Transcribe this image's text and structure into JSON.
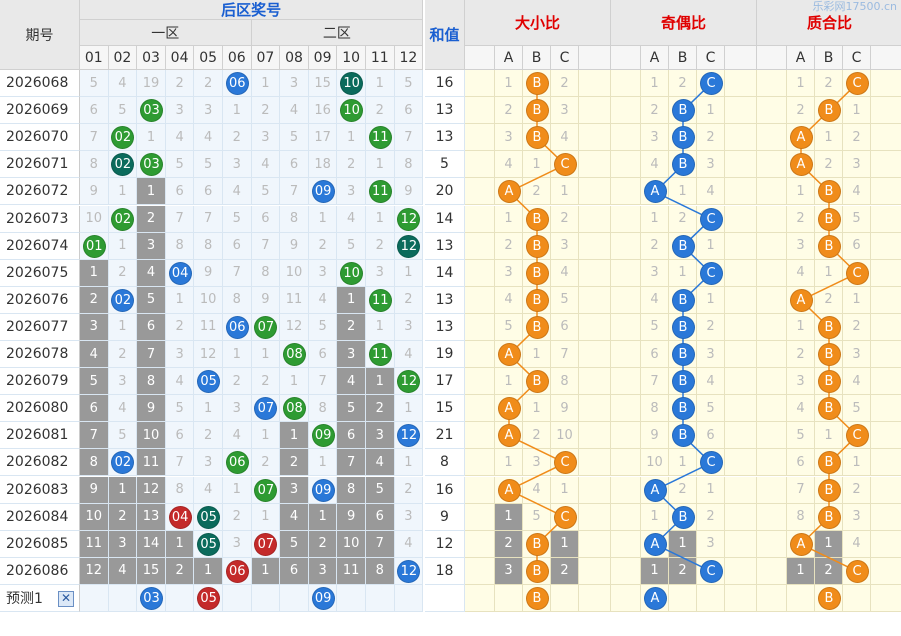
{
  "watermark": "乐彩网17500.cn",
  "header": {
    "period": "期号",
    "back_area": "后区奖号",
    "zone1": "一区",
    "zone2": "二区",
    "sum": "和值",
    "size_ratio": "大小比",
    "odd_even": "奇偶比",
    "prime_ratio": "质合比"
  },
  "numbers": [
    "01",
    "02",
    "03",
    "04",
    "05",
    "06",
    "07",
    "08",
    "09",
    "10",
    "11",
    "12"
  ],
  "abc": [
    "A",
    "B",
    "C"
  ],
  "predict_label": "预测1",
  "predict_close": "✕",
  "colors": {
    "green": "#2e9b32",
    "teal": "#0b6b5c",
    "blue": "#2a78d8",
    "red": "#c42a2a",
    "orange": "#f08c1a",
    "header_blue": "#1a5fd1",
    "header_red": "#e00000"
  },
  "rows": [
    {
      "id": "2026068",
      "c": [
        "5",
        "4",
        "19",
        "2",
        "2",
        "b:06:blue",
        "1",
        "3",
        "15",
        "b:10:teal",
        "1",
        "5"
      ],
      "sum": "16",
      "s": [
        "1",
        "b:B",
        "2"
      ],
      "o": [
        "1",
        "2",
        "b:C"
      ],
      "p": [
        "1",
        "2",
        "b:C"
      ]
    },
    {
      "id": "2026069",
      "c": [
        "6",
        "5",
        "b:03:green",
        "3",
        "3",
        "1",
        "2",
        "4",
        "16",
        "b:10:green",
        "2",
        "6"
      ],
      "sum": "13",
      "s": [
        "2",
        "b:B",
        "3"
      ],
      "o": [
        "2",
        "b:B",
        "1"
      ],
      "p": [
        "2",
        "b:B",
        "1"
      ]
    },
    {
      "id": "2026070",
      "c": [
        "7",
        "b:02:green",
        "1",
        "4",
        "4",
        "2",
        "3",
        "5",
        "17",
        "1",
        "b:11:green",
        "7"
      ],
      "sum": "13",
      "s": [
        "3",
        "b:B",
        "4"
      ],
      "o": [
        "3",
        "b:B",
        "2"
      ],
      "p": [
        "b:A",
        "1",
        "2"
      ]
    },
    {
      "id": "2026071",
      "c": [
        "8",
        "b:02:teal",
        "b:03:green",
        "5",
        "5",
        "3",
        "4",
        "6",
        "18",
        "2",
        "1",
        "8"
      ],
      "sum": "5",
      "s": [
        "4",
        "1",
        "b:C"
      ],
      "o": [
        "4",
        "b:B",
        "3"
      ],
      "p": [
        "b:A",
        "2",
        "3"
      ]
    },
    {
      "id": "2026072",
      "c": [
        "9",
        "1",
        "g:1",
        "6",
        "6",
        "4",
        "5",
        "7",
        "b:09:blue",
        "3",
        "b:11:green",
        "9"
      ],
      "sum": "20",
      "s": [
        "b:A",
        "2",
        "1"
      ],
      "o": [
        "b:A",
        "1",
        "4"
      ],
      "p": [
        "1",
        "b:B",
        "4"
      ]
    },
    {
      "id": "2026073",
      "c": [
        "10",
        "b:02:green",
        "g:2",
        "7",
        "7",
        "5",
        "6",
        "8",
        "1",
        "4",
        "1",
        "b:12:green"
      ],
      "sum": "14",
      "s": [
        "1",
        "b:B",
        "2"
      ],
      "o": [
        "1",
        "2",
        "b:C"
      ],
      "p": [
        "2",
        "b:B",
        "5"
      ]
    },
    {
      "id": "2026074",
      "c": [
        "b:01:green",
        "1",
        "g:3",
        "8",
        "8",
        "6",
        "7",
        "9",
        "2",
        "5",
        "2",
        "b:12:teal"
      ],
      "sum": "13",
      "s": [
        "2",
        "b:B",
        "3"
      ],
      "o": [
        "2",
        "b:B",
        "1"
      ],
      "p": [
        "3",
        "b:B",
        "6"
      ]
    },
    {
      "id": "2026075",
      "c": [
        "g:1",
        "2",
        "g:4",
        "b:04:blue",
        "9",
        "7",
        "8",
        "10",
        "3",
        "b:10:green",
        "3",
        "1"
      ],
      "sum": "14",
      "s": [
        "3",
        "b:B",
        "4"
      ],
      "o": [
        "3",
        "1",
        "b:C"
      ],
      "p": [
        "4",
        "1",
        "b:C"
      ]
    },
    {
      "id": "2026076",
      "c": [
        "g:2",
        "b:02:blue",
        "g:5",
        "1",
        "10",
        "8",
        "9",
        "11",
        "4",
        "g:1",
        "b:11:green",
        "2"
      ],
      "sum": "13",
      "s": [
        "4",
        "b:B",
        "5"
      ],
      "o": [
        "4",
        "b:B",
        "1"
      ],
      "p": [
        "b:A",
        "2",
        "1"
      ]
    },
    {
      "id": "2026077",
      "c": [
        "g:3",
        "1",
        "g:6",
        "2",
        "11",
        "b:06:blue",
        "b:07:green",
        "12",
        "5",
        "g:2",
        "1",
        "3"
      ],
      "sum": "13",
      "s": [
        "5",
        "b:B",
        "6"
      ],
      "o": [
        "5",
        "b:B",
        "2"
      ],
      "p": [
        "1",
        "b:B",
        "2"
      ]
    },
    {
      "id": "2026078",
      "c": [
        "g:4",
        "2",
        "g:7",
        "3",
        "12",
        "1",
        "1",
        "b:08:green",
        "6",
        "g:3",
        "b:11:green",
        "4"
      ],
      "sum": "19",
      "s": [
        "b:A",
        "1",
        "7"
      ],
      "o": [
        "6",
        "b:B",
        "3"
      ],
      "p": [
        "2",
        "b:B",
        "3"
      ]
    },
    {
      "id": "2026079",
      "c": [
        "g:5",
        "3",
        "g:8",
        "4",
        "b:05:blue",
        "2",
        "2",
        "1",
        "7",
        "g:4",
        "g:1",
        "b:12:green"
      ],
      "sum": "17",
      "s": [
        "1",
        "b:B",
        "8"
      ],
      "o": [
        "7",
        "b:B",
        "4"
      ],
      "p": [
        "3",
        "b:B",
        "4"
      ]
    },
    {
      "id": "2026080",
      "c": [
        "g:6",
        "4",
        "g:9",
        "5",
        "1",
        "3",
        "b:07:blue",
        "b:08:green",
        "8",
        "g:5",
        "g:2",
        "1"
      ],
      "sum": "15",
      "s": [
        "b:A",
        "1",
        "9"
      ],
      "o": [
        "8",
        "b:B",
        "5"
      ],
      "p": [
        "4",
        "b:B",
        "5"
      ]
    },
    {
      "id": "2026081",
      "c": [
        "g:7",
        "5",
        "g:10",
        "6",
        "2",
        "4",
        "1",
        "g:1",
        "b:09:green",
        "g:6",
        "g:3",
        "b:12:blue"
      ],
      "sum": "21",
      "s": [
        "b:A",
        "2",
        "10"
      ],
      "o": [
        "9",
        "b:B",
        "6"
      ],
      "p": [
        "5",
        "1",
        "b:C"
      ]
    },
    {
      "id": "2026082",
      "c": [
        "g:8",
        "b:02:blue",
        "g:11",
        "7",
        "3",
        "b:06:green",
        "2",
        "g:2",
        "1",
        "g:7",
        "g:4",
        "1"
      ],
      "sum": "8",
      "s": [
        "1",
        "3",
        "b:C"
      ],
      "o": [
        "10",
        "1",
        "b:C"
      ],
      "p": [
        "6",
        "b:B",
        "1"
      ]
    },
    {
      "id": "2026083",
      "c": [
        "g:9",
        "g:1",
        "g:12",
        "8",
        "4",
        "1",
        "b:07:green",
        "g:3",
        "b:09:blue",
        "g:8",
        "g:5",
        "2"
      ],
      "sum": "16",
      "s": [
        "b:A",
        "4",
        "1"
      ],
      "o": [
        "b:A",
        "2",
        "1"
      ],
      "p": [
        "7",
        "b:B",
        "2"
      ]
    },
    {
      "id": "2026084",
      "c": [
        "g:10",
        "g:2",
        "g:13",
        "b:04:red",
        "b:05:teal",
        "2",
        "1",
        "g:4",
        "g:1",
        "g:9",
        "g:6",
        "3"
      ],
      "sum": "9",
      "s": [
        "g:1",
        "5",
        "b:C"
      ],
      "o": [
        "1",
        "b:B",
        "2"
      ],
      "p": [
        "8",
        "b:B",
        "3"
      ]
    },
    {
      "id": "2026085",
      "c": [
        "g:11",
        "g:3",
        "g:14",
        "g:1",
        "b:05:teal",
        "3",
        "b:07:red",
        "g:5",
        "g:2",
        "g:10",
        "g:7",
        "4"
      ],
      "sum": "12",
      "s": [
        "g:2",
        "b:B",
        "g:1"
      ],
      "o": [
        "b:A",
        "g:1",
        "3"
      ],
      "p": [
        "b:A",
        "g:1",
        "4"
      ]
    },
    {
      "id": "2026086",
      "c": [
        "g:12",
        "g:4",
        "g:15",
        "g:2",
        "g:1",
        "b:06:red",
        "g:1",
        "g:6",
        "g:3",
        "g:11",
        "g:8",
        "b:12:blue"
      ],
      "sum": "18",
      "s": [
        "g:3",
        "b:B",
        "g:2"
      ],
      "o": [
        "g:1",
        "g:2",
        "b:C"
      ],
      "p": [
        "g:1",
        "g:2",
        "b:C"
      ]
    }
  ],
  "predict": {
    "balls": [
      {
        "col": 3,
        "label": "03",
        "color": "blue"
      },
      {
        "col": 5,
        "label": "05",
        "color": "red"
      },
      {
        "col": 9,
        "label": "09",
        "color": "blue"
      }
    ],
    "s": "B",
    "o": "A",
    "p": "B"
  }
}
